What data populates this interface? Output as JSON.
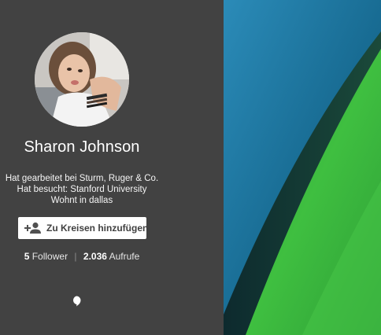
{
  "profile": {
    "name": "Sharon Johnson",
    "details": [
      "Hat gearbeitet bei Sturm, Ruger & Co.",
      "Hat besucht: Stanford University",
      "Wohnt in dallas"
    ],
    "add_button_label": "Zu Kreisen hinzufügen",
    "followers_count": "5",
    "followers_label": "Follower",
    "separator": "|",
    "views_count": "2.036",
    "views_label": "Aufrufe"
  },
  "icons": {
    "add_person": "person-add-icon",
    "comment": "comment-icon"
  },
  "colors": {
    "panel_background": "#424242",
    "cover_blue": "#1f6f9a",
    "cover_green": "#35b43c",
    "button_background": "#ffffff"
  }
}
